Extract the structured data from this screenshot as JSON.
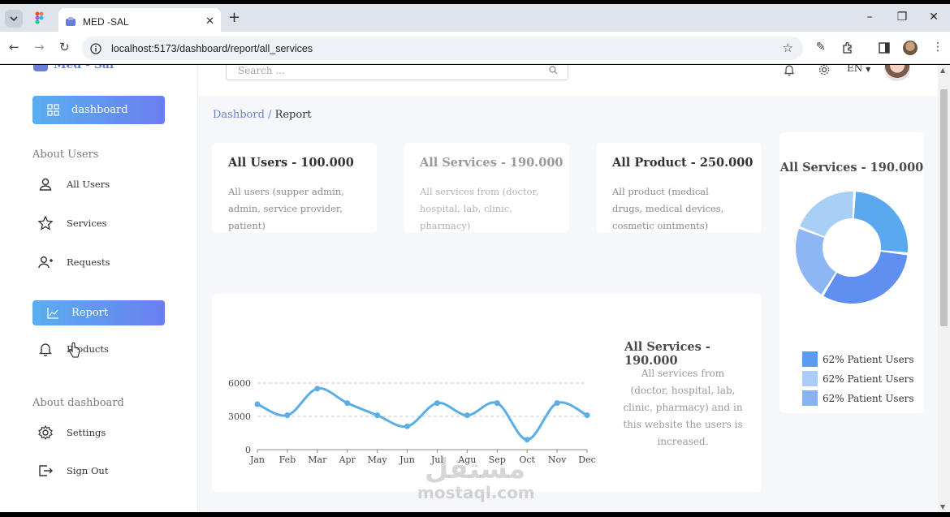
{
  "browser": {
    "tab_title": "MED -SAL",
    "url": "localhost:5173/dashboard/report/all_services",
    "tab_close_icon": "close-icon",
    "new_tab_icon": "plus-icon"
  },
  "sidebar": {
    "logo": "Med - Sal",
    "dashboard_btn": "dashboard",
    "section_users": "About Users",
    "items_users": [
      {
        "label": "All Users",
        "icon": "user-icon"
      },
      {
        "label": "Services",
        "icon": "star-icon"
      },
      {
        "label": "Requests",
        "icon": "user-plus-icon"
      }
    ],
    "report_btn": "Report",
    "products_item": "Products",
    "section_dashboard": "About dashboard",
    "items_dashboard": [
      {
        "label": "Settings",
        "icon": "gear-icon"
      },
      {
        "label": "Sign Out",
        "icon": "sign-out-icon"
      }
    ]
  },
  "topbar": {
    "search_placeholder": "Search ...",
    "language": "EN"
  },
  "breadcrumb": {
    "link": "Dashbord",
    "separator": "/",
    "current": "Report"
  },
  "cards": [
    {
      "title": "All Users - 100.000",
      "desc": "All users (supper admin, admin, service provider, patient)"
    },
    {
      "title": "All Services - 190.000",
      "desc": "All services from (doctor, hospital, lab, clinic, pharmacy)"
    },
    {
      "title": "All Product - 250.000",
      "desc": "All product (medical drugs, medical devices, cosmetic ointments)"
    }
  ],
  "donut_card": {
    "title": "All Services - 190.000",
    "legend": [
      "62% Patient Users",
      "62% Patient Users",
      "62% Patient Users"
    ],
    "colors": [
      "#5b9cf0",
      "#a9cdf8",
      "#87b3f2"
    ]
  },
  "line_card": {
    "title": "All Services - 190.000",
    "desc": "All services from (doctor, hospital, lab, clinic, pharmacy) and in this website the users is increased."
  },
  "chart_data": [
    {
      "type": "line",
      "categories": [
        "Jan",
        "Feb",
        "Mar",
        "Apr",
        "May",
        "Jun",
        "Jul",
        "Agu",
        "Sep",
        "Oct",
        "Nov",
        "Dec"
      ],
      "series": [
        {
          "values": [
            4100,
            3100,
            5500,
            4200,
            3100,
            2100,
            4200,
            3100,
            4200,
            900,
            4200,
            3100
          ]
        }
      ],
      "yticks": [
        0,
        3000,
        6000
      ],
      "ylim": [
        0,
        6500
      ],
      "color": "#5aaee8",
      "grid": "dashed"
    },
    {
      "type": "pie",
      "donut": true,
      "values": [
        26,
        32,
        22,
        20
      ],
      "colors": [
        "#5aa9ef",
        "#5f8ff0",
        "#8db6f5",
        "#a8d0f7"
      ]
    }
  ],
  "watermark": {
    "arabic": "مستقل",
    "latin": "mostaql.com"
  }
}
